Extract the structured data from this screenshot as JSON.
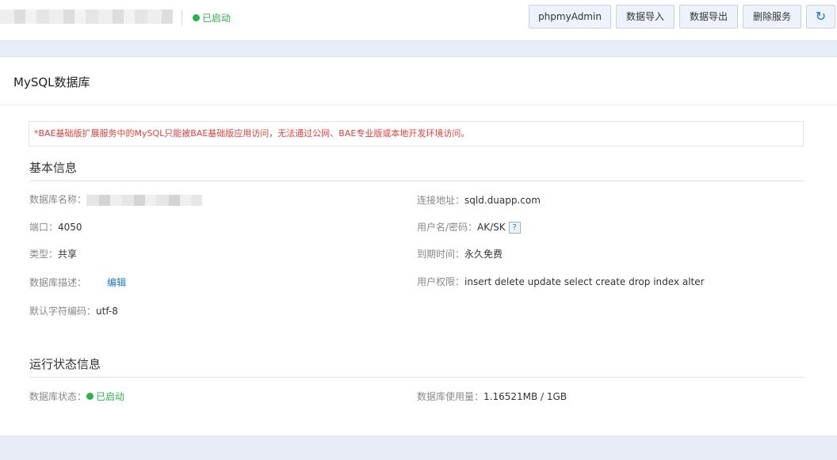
{
  "header": {
    "status_text": "已启动",
    "buttons": {
      "phpmyadmin": "phpmyAdmin",
      "import": "数据导入",
      "export": "数据导出",
      "delete": "删除服务",
      "refresh_icon": "refresh-icon"
    }
  },
  "card": {
    "title": "MySQL数据库",
    "notice": "*BAE基础版扩展服务中的MySQL只能被BAE基础版应用访问，无法通过公网、BAE专业版或本地开发环境访问。"
  },
  "basic": {
    "title": "基本信息",
    "db_name_label": "数据库名称：",
    "port_label": "端口：",
    "port_value": "4050",
    "type_label": "类型：",
    "type_value": "共享",
    "desc_label": "数据库描述：",
    "edit_link": "编辑",
    "charset_label": "默认字符编码：",
    "charset_value": "utf-8",
    "host_label": "连接地址：",
    "host_value": "sqld.duapp.com",
    "user_label": "用户名/密码：",
    "user_value": "AK/SK",
    "help_label": "?",
    "expire_label": "到期时间：",
    "expire_value": "永久免费",
    "perm_label": "用户权限：",
    "perm_value": "insert delete update select create drop index alter"
  },
  "runtime": {
    "title": "运行状态信息",
    "state_label": "数据库状态：",
    "state_value": "已启动",
    "usage_label": "数据库使用量：",
    "usage_value": "1.16521MB / 1GB"
  },
  "colors": {
    "success": "#2bb24c",
    "warning": "#e8413d",
    "link": "#1a76d2",
    "page_bg": "#e8edf5"
  }
}
